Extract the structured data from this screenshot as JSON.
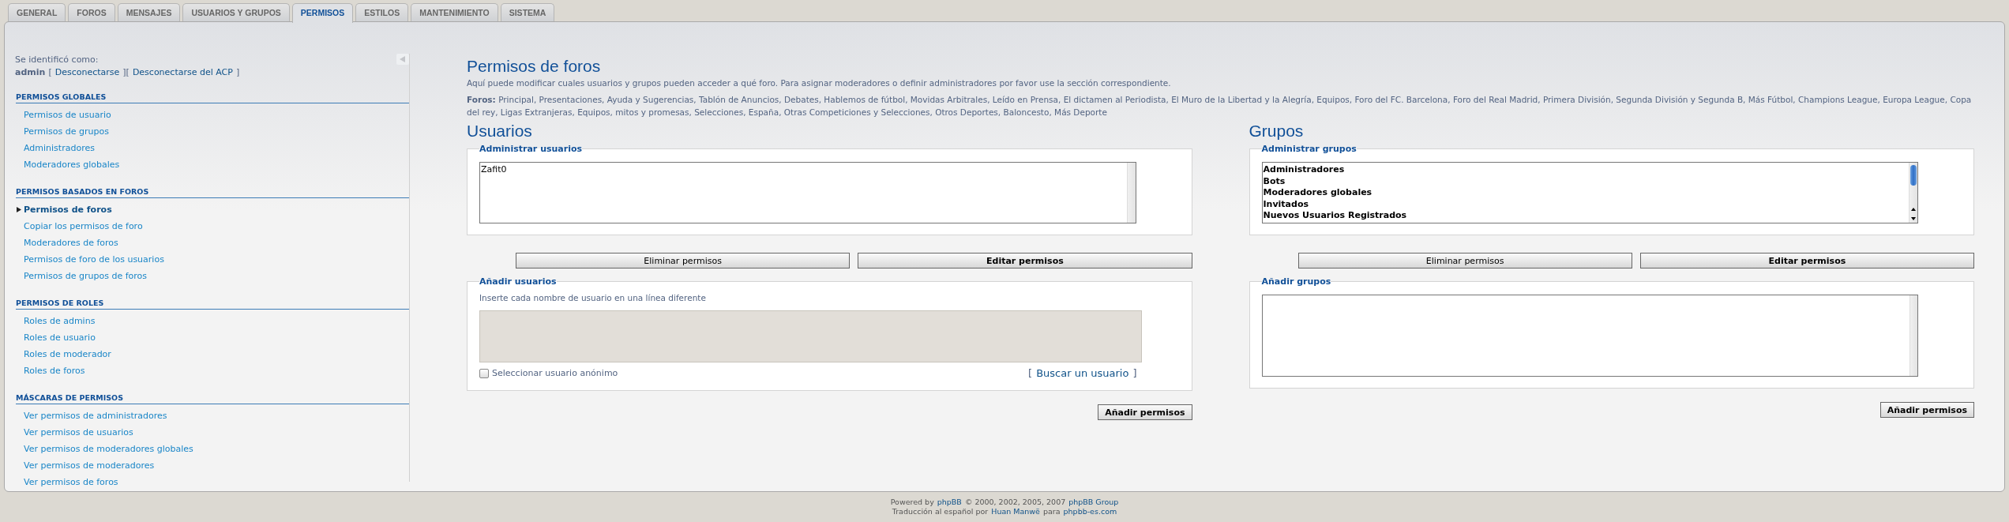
{
  "tabs": [
    {
      "label": "GENERAL",
      "selected": false
    },
    {
      "label": "FOROS",
      "selected": false
    },
    {
      "label": "MENSAJES",
      "selected": false
    },
    {
      "label": "USUARIOS Y GRUPOS",
      "selected": false
    },
    {
      "label": "PERMISOS",
      "selected": true
    },
    {
      "label": "ESTILOS",
      "selected": false
    },
    {
      "label": "MANTENIMIENTO",
      "selected": false
    },
    {
      "label": "SISTEMA",
      "selected": false
    }
  ],
  "sidebar": {
    "identified_label": "Se identificó como:",
    "account_line": [
      {
        "kind": "user",
        "text": "admin"
      },
      {
        "kind": "text",
        "text": "["
      },
      {
        "kind": "link",
        "text": "Desconectarse"
      },
      {
        "kind": "text",
        "text": "]["
      },
      {
        "kind": "link",
        "text": "Desconectarse del ACP"
      },
      {
        "kind": "text",
        "text": "]"
      }
    ],
    "sections": [
      {
        "title": "PERMISOS GLOBALES",
        "items": [
          {
            "label": "Permisos de usuario",
            "selected": false
          },
          {
            "label": "Permisos de grupos",
            "selected": false
          },
          {
            "label": "Administradores",
            "selected": false
          },
          {
            "label": "Moderadores globales",
            "selected": false
          }
        ]
      },
      {
        "title": "PERMISOS BASADOS EN FOROS",
        "items": [
          {
            "label": "Permisos de foros",
            "selected": true
          },
          {
            "label": "Copiar los permisos de foro",
            "selected": false
          },
          {
            "label": "Moderadores de foros",
            "selected": false
          },
          {
            "label": "Permisos de foro de los usuarios",
            "selected": false
          },
          {
            "label": "Permisos de grupos de foros",
            "selected": false
          }
        ]
      },
      {
        "title": "PERMISOS DE ROLES",
        "items": [
          {
            "label": "Roles de admins",
            "selected": false
          },
          {
            "label": "Roles de usuario",
            "selected": false
          },
          {
            "label": "Roles de moderador",
            "selected": false
          },
          {
            "label": "Roles de foros",
            "selected": false
          }
        ]
      },
      {
        "title": "MÁSCARAS DE PERMISOS",
        "items": [
          {
            "label": "Ver permisos de administradores",
            "selected": false
          },
          {
            "label": "Ver permisos de usuarios",
            "selected": false
          },
          {
            "label": "Ver permisos de moderadores globales",
            "selected": false
          },
          {
            "label": "Ver permisos de moderadores",
            "selected": false
          },
          {
            "label": "Ver permisos de foros",
            "selected": false
          }
        ]
      }
    ]
  },
  "content": {
    "title": "Permisos de foros",
    "description": "Aquí puede modificar cuales usuarios y grupos pueden acceder a qué foro. Para asignar moderadores o definir administradores por favor use la sección correspondiente.",
    "forums": "**Foros:** Principal, Presentaciones, Ayuda y Sugerencias, Tablón de Anuncios, Debates, Hablemos de fútbol, Movidas Arbitrales, Leído en Prensa, El dictamen al Periodista, El Muro de la Libertad y la Alegría, Equipos, Foro del FC. Barcelona, Foro del Real Madrid, Primera División, Segunda División y Segunda B, Más Fútbol, Champions League, Europa League, Copa del rey, Ligas Extranjeras, Equipos, mitos y promesas, Selecciones, España, Otras Competiciones y Selecciones, Otros Deportes, Baloncesto, Más Deporte",
    "columns": [
      {
        "kind": "users",
        "heading": "Usuarios",
        "manage_legend": "Administrar usuarios",
        "options": [
          "Zafit0"
        ],
        "remove_button": "Eliminar permisos",
        "edit_button": "Editar permisos",
        "add_legend": "Añadir usuarios",
        "hint": "Inserte cada nombre de usuario en una línea diferente",
        "anonymous": {
          "label": "Seleccionar usuario anónimo",
          "checked": false
        },
        "find_prefix": "[",
        "find_link": "Buscar un usuario",
        "find_suffix": "]",
        "submit_button": "Añadir permisos"
      },
      {
        "kind": "groups",
        "heading": "Grupos",
        "manage_legend": "Administrar grupos",
        "options": [
          "Administradores",
          "Bots",
          "Moderadores globales",
          "Invitados",
          "Nuevos Usuarios Registrados"
        ],
        "remove_button": "Eliminar permisos",
        "edit_button": "Editar permisos",
        "add_legend": "Añadir grupos",
        "submit_button": "Añadir permisos"
      }
    ]
  },
  "footer": [
    [
      {
        "text": "Powered by",
        "link": false
      },
      {
        "text": "phpBB",
        "link": true
      },
      {
        "text": "© 2000, 2002, 2005, 2007",
        "link": false
      },
      {
        "text": "phpBB Group",
        "link": true
      }
    ],
    [
      {
        "text": "Traducción al español por",
        "link": false
      },
      {
        "text": "Huan Manwë",
        "link": true
      },
      {
        "text": "para",
        "link": false
      },
      {
        "text": "phpbb-es.com",
        "link": true
      }
    ]
  ]
}
